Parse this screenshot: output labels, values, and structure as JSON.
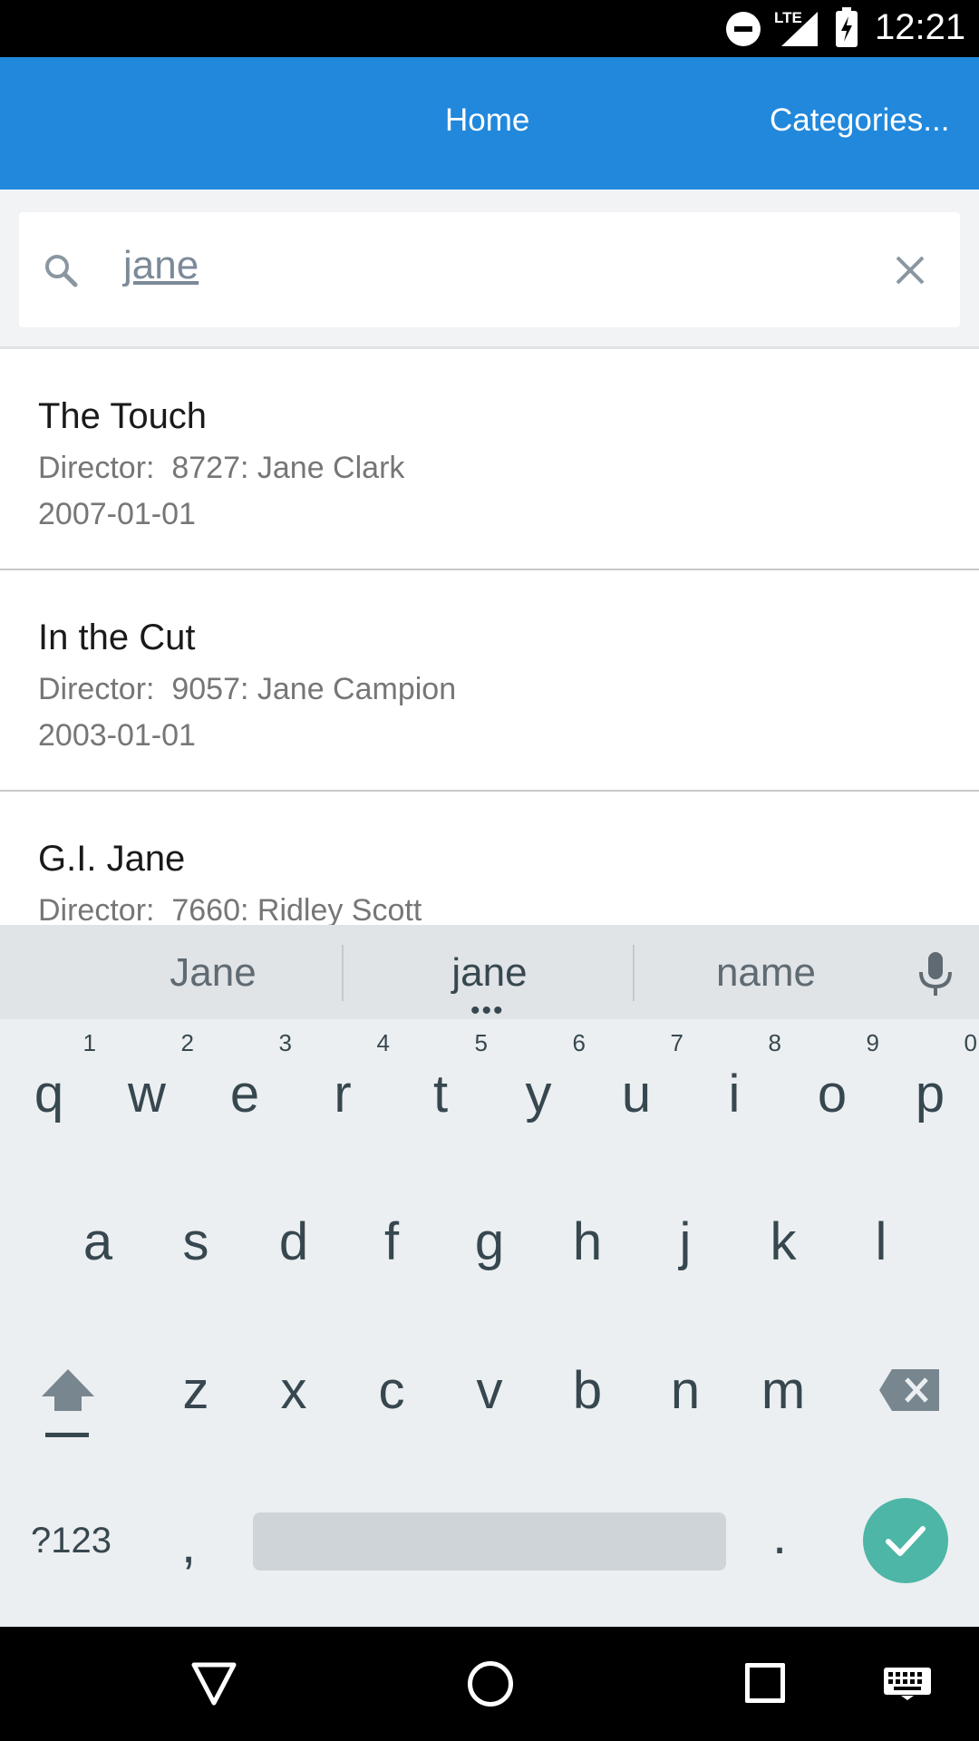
{
  "status_bar": {
    "network": "LTE",
    "time": "12:21",
    "icons": [
      "do-not-disturb-icon",
      "signal-icon",
      "battery-charging-icon"
    ]
  },
  "app_bar": {
    "nav": [
      {
        "label": "Home"
      },
      {
        "label": "Categories..."
      }
    ],
    "color": "#2188dc"
  },
  "search": {
    "value": "jane",
    "icon": "search-icon",
    "clear_icon": "close-icon"
  },
  "results": [
    {
      "title": "The Touch",
      "director": "Director:  8727: Jane Clark",
      "date": "2007-01-01"
    },
    {
      "title": "In the Cut",
      "director": "Director:  9057: Jane Campion",
      "date": "2003-01-01"
    },
    {
      "title": "G.I. Jane",
      "director": "Director:  7660: Ridley Scott",
      "date": ""
    }
  ],
  "keyboard": {
    "suggestions": [
      "Jane",
      "jane",
      "name"
    ],
    "row1": [
      {
        "key": "q",
        "hint": "1"
      },
      {
        "key": "w",
        "hint": "2"
      },
      {
        "key": "e",
        "hint": "3"
      },
      {
        "key": "r",
        "hint": "4"
      },
      {
        "key": "t",
        "hint": "5"
      },
      {
        "key": "y",
        "hint": "6"
      },
      {
        "key": "u",
        "hint": "7"
      },
      {
        "key": "i",
        "hint": "8"
      },
      {
        "key": "o",
        "hint": "9"
      },
      {
        "key": "p",
        "hint": "0"
      }
    ],
    "row2": [
      "a",
      "s",
      "d",
      "f",
      "g",
      "h",
      "j",
      "k",
      "l"
    ],
    "row3": [
      "z",
      "x",
      "c",
      "v",
      "b",
      "n",
      "m"
    ],
    "symbols_label": "?123",
    "comma": ",",
    "period": ".",
    "done_color": "#4db6a6"
  },
  "nav_bar": {
    "icons": [
      "back-icon",
      "home-icon",
      "recents-icon",
      "keyboard-icon"
    ]
  }
}
